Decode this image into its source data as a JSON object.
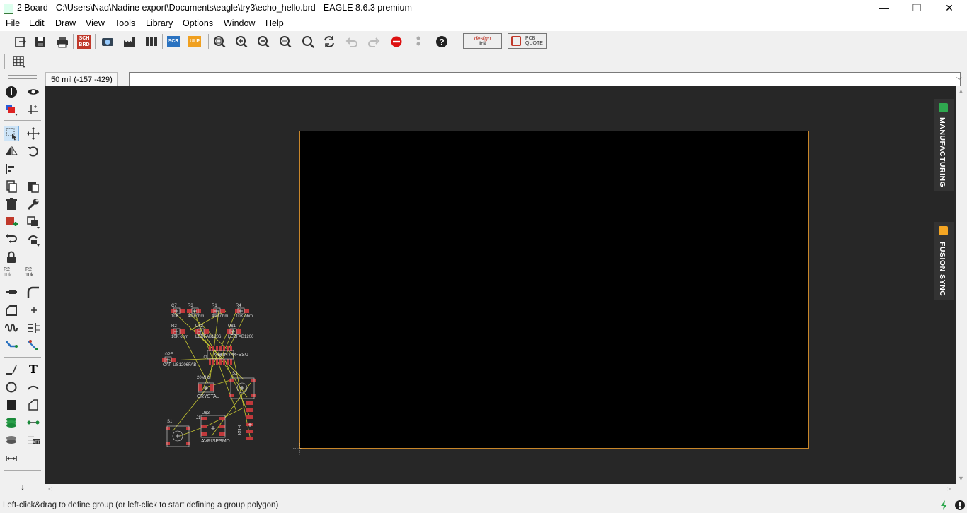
{
  "window": {
    "title": "2 Board - C:\\Users\\Nad\\Nadine export\\Documents\\eagle\\try3\\echo_hello.brd - EAGLE 8.6.3 premium",
    "minimize_glyph": "—",
    "maximize_glyph": "❐",
    "close_glyph": "✕"
  },
  "menu": {
    "items": [
      {
        "label": "File"
      },
      {
        "label": "Edit"
      },
      {
        "label": "Draw"
      },
      {
        "label": "View"
      },
      {
        "label": "Tools"
      },
      {
        "label": "Library"
      },
      {
        "label": "Options"
      },
      {
        "label": "Window"
      },
      {
        "label": "Help"
      }
    ]
  },
  "toolbar": {
    "sch_brd_label_top": "SCH",
    "sch_brd_label_bottom": "BRD",
    "scr_label": "SCR",
    "ulp_label": "ULP",
    "designlink_top": "design",
    "designlink_bottom": "link",
    "pcbquote_top": "PCB",
    "pcbquote_bottom": "QUOTE"
  },
  "coord": {
    "readout": "50 mil (-157 -429)",
    "command_value": ""
  },
  "side_tabs": {
    "manufacturing": "MANUFACTURING",
    "fusion_sync": "FUSION SYNC"
  },
  "left_tools": {
    "smash_value_top": "R2",
    "smash_value_bottom": "10k",
    "text_tool": "T"
  },
  "parts_labels": {
    "c7": "C7",
    "r3": "R3",
    "r1": "R1",
    "r4": "R4",
    "c7_val": "10K",
    "r3_val": "499 ohm",
    "r1_val": "499 ohm",
    "r4_val": "10K ohm",
    "r2": "R2",
    "u2": "U$2",
    "u1": "U$1",
    "r2_val": "10K ohm",
    "led1": "LEDFAB1206",
    "led2": "LEDFAB1206",
    "c1": "10PF",
    "c1_val": "CAP-US1206FAB",
    "ic": "ATTINY44-SSU",
    "s2": "S2",
    "crystal_val": "20MHz",
    "crystal": "CRYSTAL",
    "s1": "S1",
    "u3": "U$3",
    "j1": "J1",
    "avrisp": "AVRISPSMD",
    "ftdi": "FTDI"
  },
  "status": {
    "message": "Left-click&drag to define group (or left-click to start defining a group polygon)"
  },
  "colors": {
    "canvas": "#272727",
    "board_fill": "#000000",
    "board_outline": "#c8862a",
    "pad": "#c0393b",
    "airwire": "#c8c832",
    "manufacturing_icon": "#2fa84f",
    "fusion_icon": "#f5a623"
  }
}
